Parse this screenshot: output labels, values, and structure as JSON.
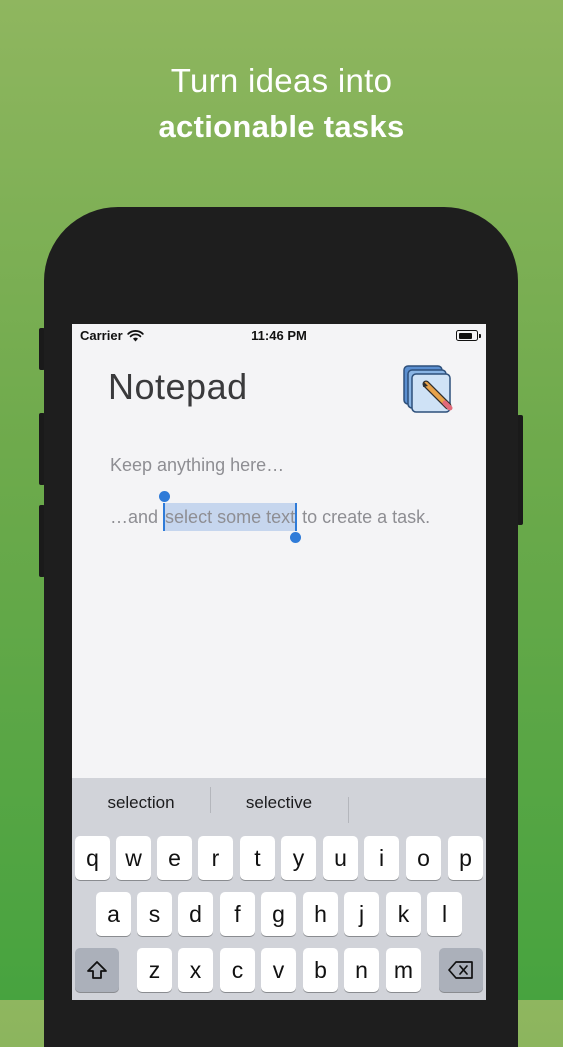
{
  "headline": {
    "line1": "Turn ideas into",
    "line2": "actionable tasks"
  },
  "status_bar": {
    "carrier": "Carrier",
    "time": "11:46 PM"
  },
  "app": {
    "title": "Notepad",
    "icon": "notes-stack-pencil-icon"
  },
  "note": {
    "line1": "Keep anything here…",
    "line2_before": "…and ",
    "line2_selected": "select some text",
    "line2_after": " to create a task."
  },
  "suggestions": [
    "selection",
    "selective",
    ""
  ],
  "keyboard": {
    "row1": [
      "q",
      "w",
      "e",
      "r",
      "t",
      "y",
      "u",
      "i",
      "o",
      "p"
    ],
    "row2": [
      "a",
      "s",
      "d",
      "f",
      "g",
      "h",
      "j",
      "k",
      "l"
    ],
    "row3": [
      "z",
      "x",
      "c",
      "v",
      "b",
      "n",
      "m"
    ],
    "shift_icon": "shift-arrow-icon",
    "delete_icon": "backspace-icon"
  },
  "colors": {
    "selection": "#c6d6ee",
    "selection_handle": "#2f7bd8",
    "background_top": "#8fb65f",
    "background_bottom": "#47a33f"
  }
}
